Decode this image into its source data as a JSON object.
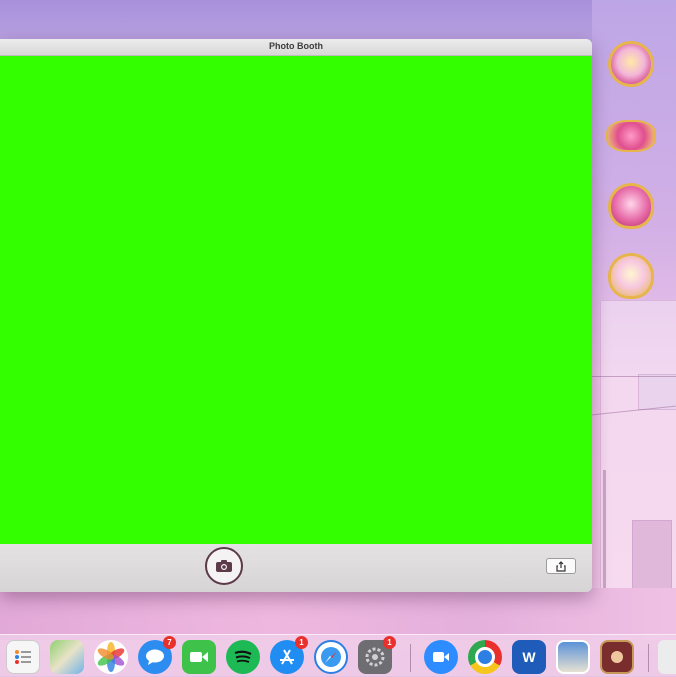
{
  "window": {
    "title": "Photo Booth",
    "preview_color": "#33ff00"
  },
  "toolbar": {
    "shutter_icon": "camera-icon",
    "share_icon": "share-icon"
  },
  "desktop_icons": [
    "brooch-icon",
    "winged-heart-brooch-icon",
    "heart-brooch-icon",
    "crystal-brooch-icon"
  ],
  "dock": {
    "items": [
      {
        "icon": "reminders-icon"
      },
      {
        "icon": "maps-icon"
      },
      {
        "icon": "photos-icon"
      },
      {
        "icon": "messages-icon",
        "badge": "7"
      },
      {
        "icon": "facetime-icon"
      },
      {
        "icon": "spotify-icon"
      },
      {
        "icon": "app-store-icon",
        "badge": "1"
      },
      {
        "icon": "safari-icon"
      },
      {
        "icon": "system-preferences-icon",
        "badge": "1"
      },
      {
        "icon": "zoom-icon"
      },
      {
        "icon": "chrome-icon"
      },
      {
        "icon": "word-icon",
        "label": "W"
      },
      {
        "icon": "preview-icon"
      },
      {
        "icon": "photo-booth-icon"
      }
    ]
  }
}
